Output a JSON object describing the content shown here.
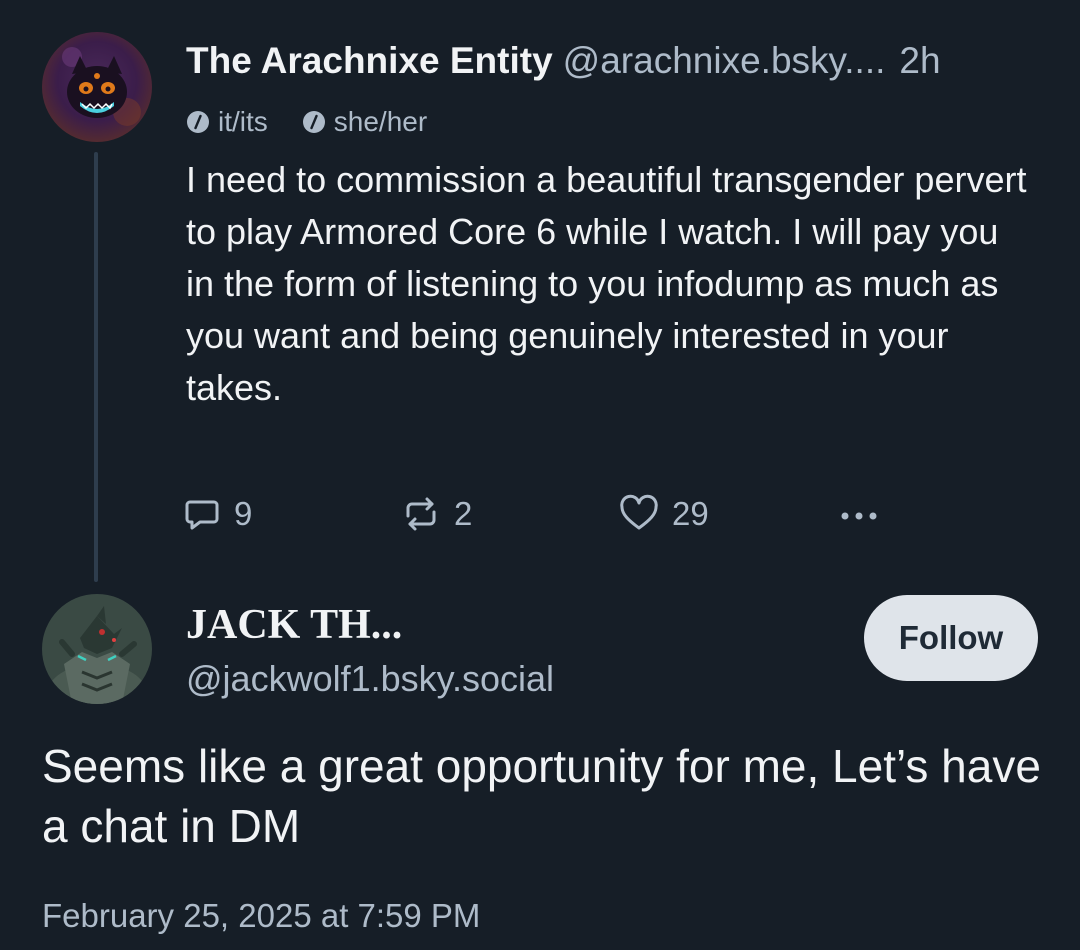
{
  "parent_post": {
    "author": {
      "display_name": "The Arachnixe Entity",
      "handle": "@arachnixe.bsky....",
      "avatar_icon": "demon-cat-avatar"
    },
    "time": "2h",
    "pronouns": [
      {
        "icon": "slash-circle-icon",
        "label": "it/its"
      },
      {
        "icon": "slash-circle-icon",
        "label": "she/her"
      }
    ],
    "text": "I need to commission a beautiful transgender pervert to play Armored Core 6 while I watch. I will pay you in the form of listening to you infodump as much as you want and being genuinely interested in your takes.",
    "actions": {
      "replies": "9",
      "reposts": "2",
      "likes": "29",
      "more_icon": "ellipsis-icon"
    }
  },
  "reply_post": {
    "author": {
      "display_name": "JACK TH...",
      "handle": "@jackwolf1.bsky.social",
      "avatar_icon": "armored-wolf-avatar"
    },
    "follow_label": "Follow",
    "text": "Seems like a great opportunity for me, Let’s have a chat in DM",
    "timestamp": "February 25, 2025 at 7:59 PM"
  },
  "colors": {
    "background": "#161e27",
    "primary_text": "#f1f3f5",
    "secondary_text": "#aebbc9",
    "thread_line": "#2e3d4d",
    "follow_button_bg": "#dfe4ea"
  }
}
